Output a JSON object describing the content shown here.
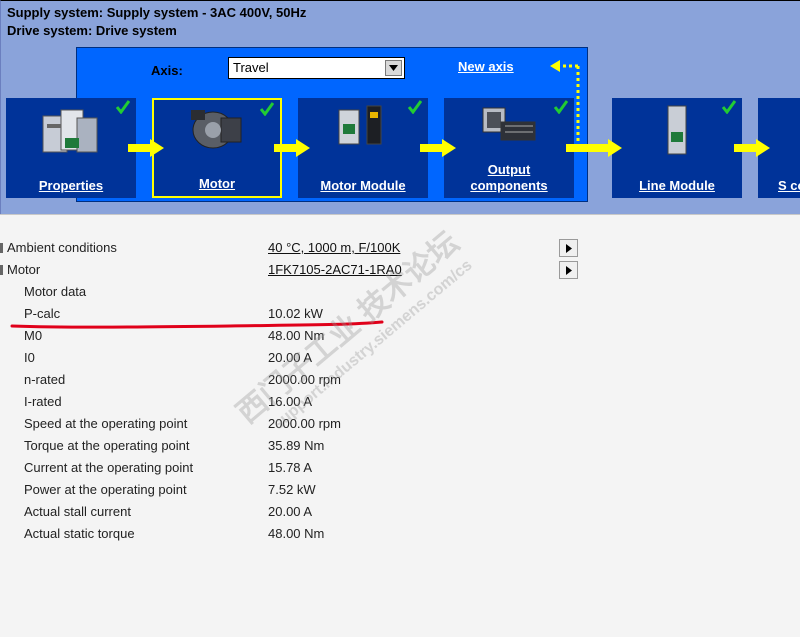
{
  "header": {
    "supply_system": "Supply system: Supply system - 3AC 400V, 50Hz",
    "drive_system": "Drive system: Drive system"
  },
  "axis": {
    "label": "Axis:",
    "selected": "Travel",
    "new_axis_link": "New axis"
  },
  "tiles": [
    {
      "label": "Properties",
      "checked": true,
      "active": false
    },
    {
      "label": "Motor",
      "checked": true,
      "active": true
    },
    {
      "label": "Motor Module",
      "checked": true,
      "active": false
    },
    {
      "label": "Output components",
      "checked": true,
      "active": false
    },
    {
      "label": "Line Module",
      "checked": true,
      "active": false
    },
    {
      "label": "S co",
      "checked": false,
      "active": false
    }
  ],
  "properties": {
    "ambient_label": "Ambient conditions",
    "ambient_value": "40 °C, 1000 m, F/100K",
    "motor_label": "Motor",
    "motor_value": "1FK7105-2AC71-1RA0",
    "motor_data_label": "Motor data",
    "rows": [
      {
        "label": "P-calc",
        "value": "10.02 kW"
      },
      {
        "label": "M0",
        "value": "48.00 Nm"
      },
      {
        "label": "I0",
        "value": "20.00 A"
      },
      {
        "label": "n-rated",
        "value": "2000.00 rpm"
      },
      {
        "label": "I-rated",
        "value": "16.00 A"
      },
      {
        "label": "Speed at the operating point",
        "value": "2000.00 rpm"
      },
      {
        "label": "Torque at the operating point",
        "value": "35.89 Nm"
      },
      {
        "label": "Current at the operating point",
        "value": "15.78 A"
      },
      {
        "label": "Power at the operating point",
        "value": "7.52 kW"
      },
      {
        "label": "Actual stall current",
        "value": "20.00 A"
      },
      {
        "label": "Actual static torque",
        "value": "48.00 Nm"
      }
    ]
  },
  "watermark": {
    "cn": "西门子工业 技术论坛",
    "url": "support.industry.siemens.com/cs"
  },
  "colors": {
    "panel_bg": "#8aa3da",
    "drive_box": "#0066ff",
    "tile_bg": "#003399",
    "arrow": "#ffff00",
    "check": "#22cc33",
    "annotation_red": "#e0001a"
  }
}
